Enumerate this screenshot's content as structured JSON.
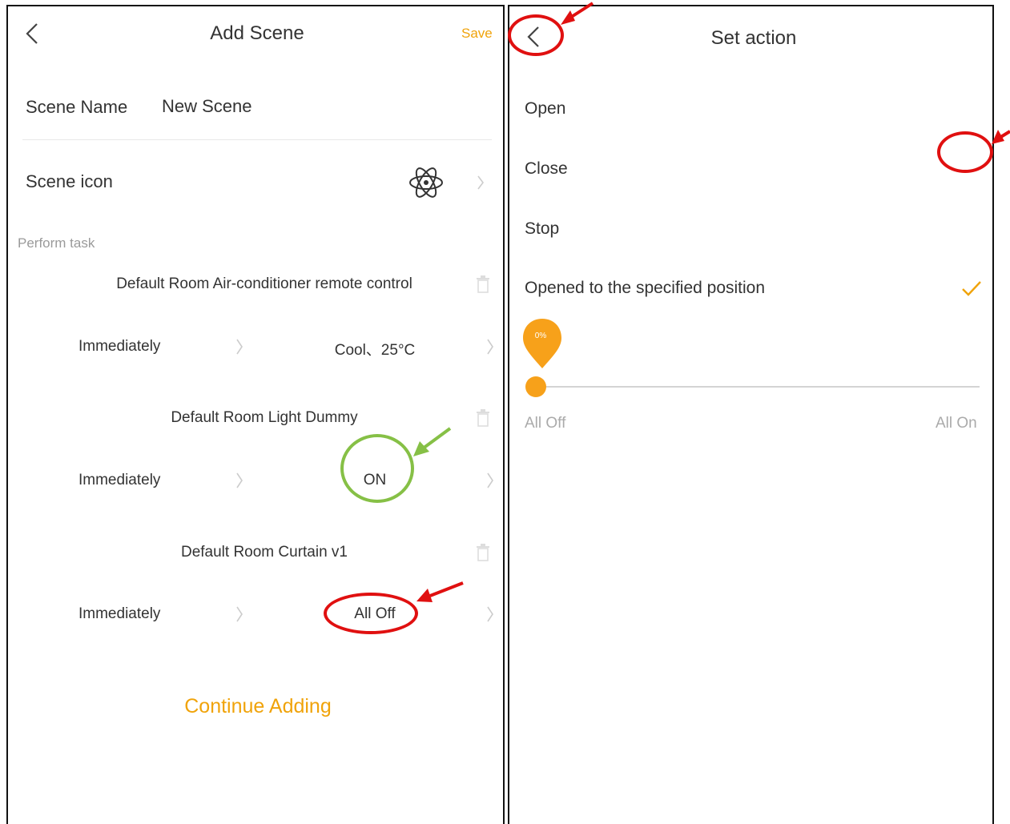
{
  "left": {
    "header": {
      "title": "Add Scene",
      "save_label": "Save"
    },
    "scene_name": {
      "label": "Scene Name",
      "value": "New Scene"
    },
    "scene_icon": {
      "label": "Scene icon",
      "icon": "atom-icon"
    },
    "perform_task": {
      "label": "Perform task"
    },
    "tasks": [
      {
        "device": "Default Room Air-conditioner remote control",
        "timing": "Immediately",
        "action": "Cool、25°C"
      },
      {
        "device": "Default Room Light Dummy",
        "timing": "Immediately",
        "action": "ON"
      },
      {
        "device": "Default Room Curtain v1",
        "timing": "Immediately",
        "action": "All Off"
      }
    ],
    "continue_label": "Continue Adding"
  },
  "right": {
    "header": {
      "title": "Set action"
    },
    "options": [
      {
        "label": "Open",
        "selected": false
      },
      {
        "label": "Close",
        "selected": false
      },
      {
        "label": "Stop",
        "selected": false
      },
      {
        "label": "Opened to the specified position",
        "selected": true
      }
    ],
    "slider": {
      "value_label": "0%",
      "value": 0,
      "min_label": "All Off",
      "max_label": "All On"
    }
  },
  "colors": {
    "accent": "#f0a30a",
    "annotation_red": "#e01010",
    "annotation_green": "#86c046"
  }
}
